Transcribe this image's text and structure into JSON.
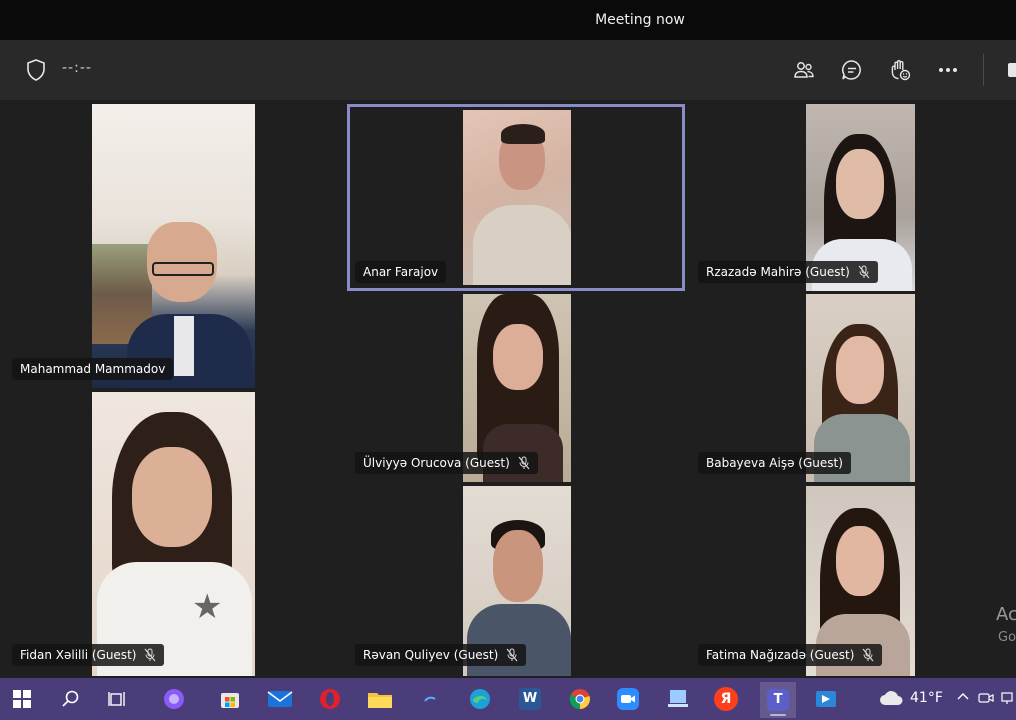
{
  "window": {
    "title": "Meeting now"
  },
  "toolbar": {
    "timer": "--:--",
    "icons": [
      "shield-icon",
      "people-icon",
      "chat-icon",
      "raise-hand-icon",
      "more-icon",
      "camera-icon"
    ]
  },
  "participants": [
    {
      "name": "Mahammad Mammadov",
      "muted": false,
      "active": false
    },
    {
      "name": "Anar Farajov",
      "muted": false,
      "active": true
    },
    {
      "name": "Rzazadə Mahirə (Guest)",
      "muted": true,
      "active": false
    },
    {
      "name": "Ülviyyə Orucova (Guest)",
      "muted": true,
      "active": false
    },
    {
      "name": "Babayeva Aişə (Guest)",
      "muted": false,
      "active": false
    },
    {
      "name": "Fidan Xəlilli (Guest)",
      "muted": true,
      "active": false
    },
    {
      "name": "Rəvan Quliyev (Guest)",
      "muted": true,
      "active": false
    },
    {
      "name": "Fatima Nağızadə (Guest)",
      "muted": true,
      "active": false
    }
  ],
  "watermark": {
    "line1": "Ac",
    "line2": "Go"
  },
  "taskbar": {
    "weather_temp": "41°F",
    "items": [
      "windows-start-icon",
      "search-icon",
      "task-view-icon",
      "cortana-icon",
      "store-icon",
      "mail-icon",
      "opera-icon",
      "file-explorer-icon",
      "app-icon",
      "edge-icon",
      "word-icon",
      "chrome-icon",
      "zoom-icon",
      "media-icon",
      "yandex-icon",
      "teams-icon",
      "whiteboard-icon"
    ],
    "yandex_glyph": "Я",
    "word_glyph": "W",
    "teams_glyph": "T"
  },
  "colors": {
    "active_outline": "#8b8cc7",
    "taskbar": "#4b3d7a",
    "background": "#1f1f1f"
  }
}
